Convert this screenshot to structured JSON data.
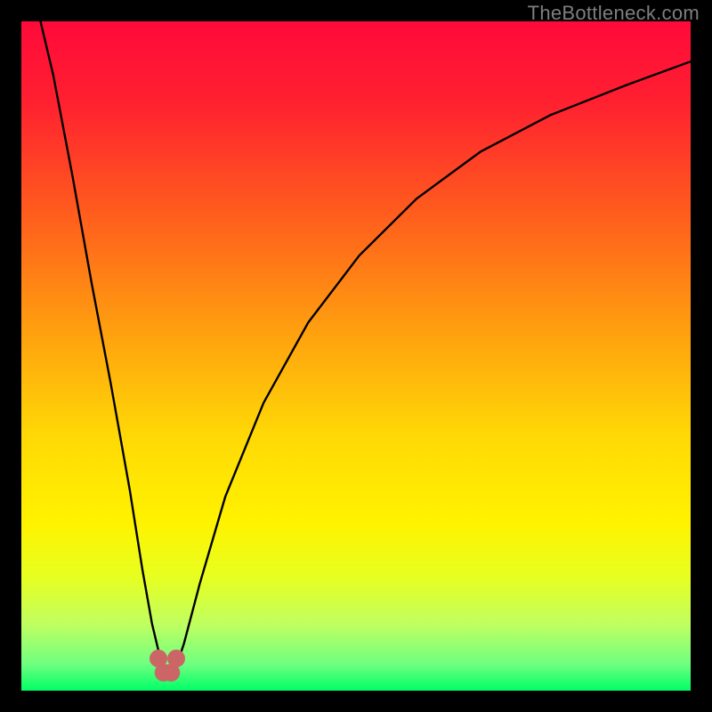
{
  "watermark": "TheBottleneck.com",
  "chart_data": {
    "type": "line",
    "title": "",
    "xlabel": "",
    "ylabel": "",
    "xlim": [
      -5,
      100
    ],
    "ylim": [
      0,
      100
    ],
    "background": {
      "gradient_stops": [
        {
          "t": 0.0,
          "hex": "#ff0a3a"
        },
        {
          "t": 0.12,
          "hex": "#ff2030"
        },
        {
          "t": 0.28,
          "hex": "#ff5a1e"
        },
        {
          "t": 0.45,
          "hex": "#ff9b10"
        },
        {
          "t": 0.62,
          "hex": "#ffd906"
        },
        {
          "t": 0.75,
          "hex": "#fff300"
        },
        {
          "t": 0.83,
          "hex": "#e7ff20"
        },
        {
          "t": 0.9,
          "hex": "#c0ff60"
        },
        {
          "t": 0.96,
          "hex": "#70ff80"
        },
        {
          "t": 1.0,
          "hex": "#00ff66"
        }
      ]
    },
    "series": [
      {
        "name": "left-branch",
        "x": [
          -2.0,
          0.0,
          3.0,
          6.0,
          9.0,
          12.0,
          14.0,
          15.5,
          16.5,
          17.3
        ],
        "y": [
          100.0,
          92.0,
          77.0,
          61.0,
          46.0,
          30.0,
          18.0,
          10.0,
          6.0,
          3.3
        ]
      },
      {
        "name": "right-branch",
        "x": [
          19.2,
          20.5,
          23.0,
          27.0,
          33.0,
          40.0,
          48.0,
          57.0,
          67.0,
          78.0,
          90.0,
          100.0
        ],
        "y": [
          3.3,
          7.0,
          16.0,
          29.0,
          43.0,
          55.0,
          65.0,
          73.5,
          80.5,
          86.0,
          90.5,
          94.0
        ]
      }
    ],
    "markers": {
      "name": "valley-points",
      "fill": "#cc6666",
      "radius": 10,
      "points": [
        {
          "x": 16.5,
          "y": 4.8
        },
        {
          "x": 17.3,
          "y": 2.7
        },
        {
          "x": 18.5,
          "y": 2.7
        },
        {
          "x": 19.3,
          "y": 4.8
        }
      ]
    }
  }
}
